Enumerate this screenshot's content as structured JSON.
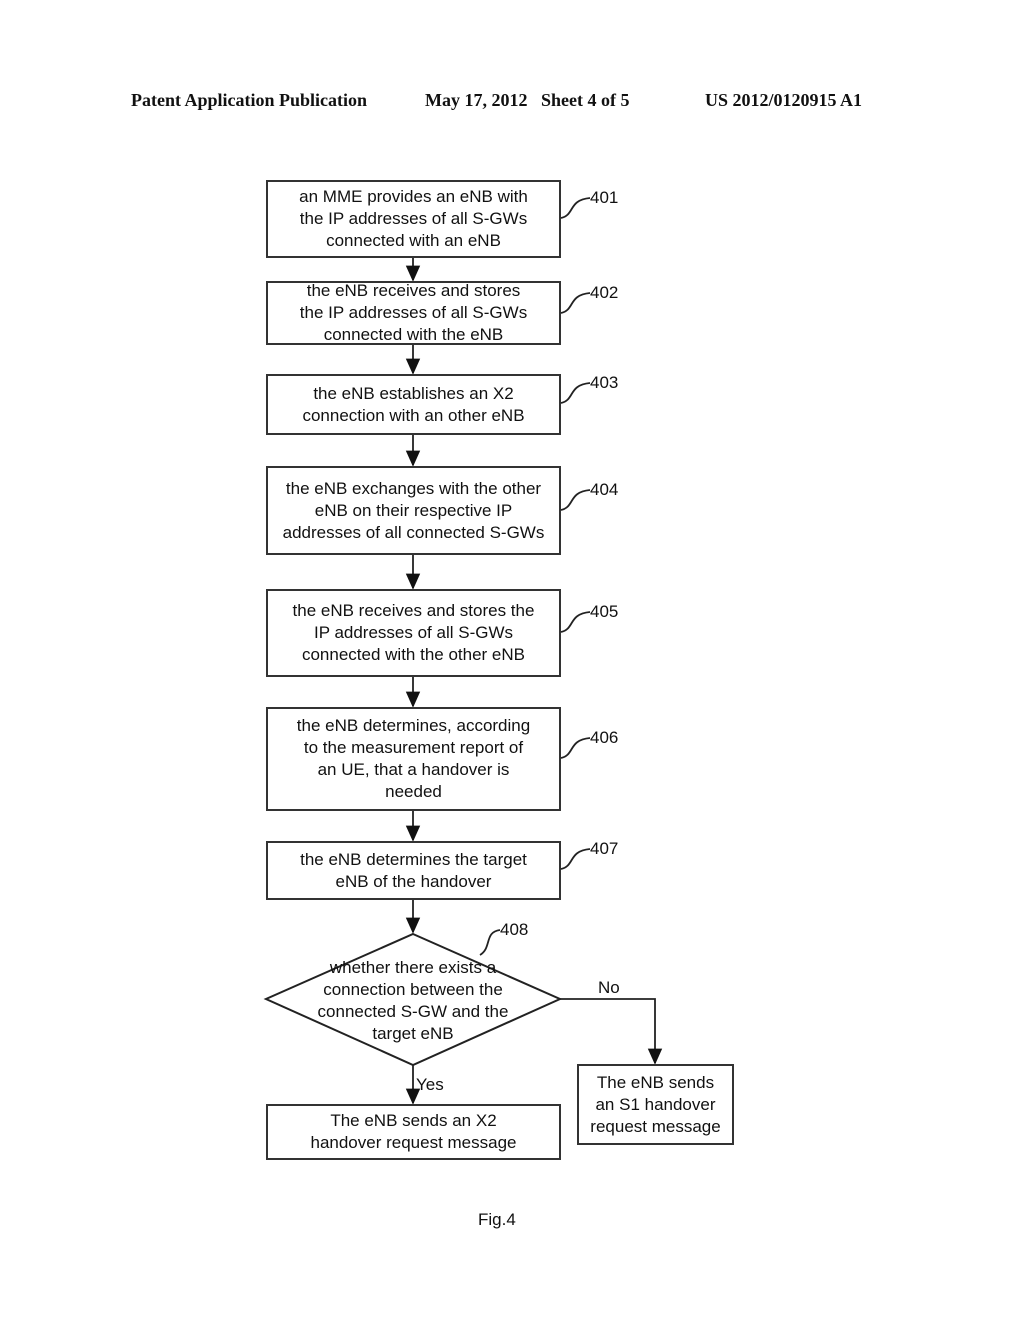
{
  "header": {
    "publication": "Patent Application Publication",
    "date_sheet": "May 17, 2012   Sheet 4 of 5",
    "number": "US 2012/0120915 A1"
  },
  "steps": [
    {
      "ref": "401",
      "text": "an MME provides an eNB with\nthe IP addresses of all S-GWs\nconnected with an eNB"
    },
    {
      "ref": "402",
      "text": "the eNB receives and stores\nthe IP addresses of all S-GWs\nconnected with the eNB"
    },
    {
      "ref": "403",
      "text": "the eNB establishes an X2\nconnection with an other eNB"
    },
    {
      "ref": "404",
      "text": "the eNB exchanges with the other\neNB on their respective IP\naddresses of all connected S-GWs"
    },
    {
      "ref": "405",
      "text": "the eNB receives and stores the\nIP addresses of all  S-GWs\nconnected with the other eNB"
    },
    {
      "ref": "406",
      "text": "the eNB determines, according\nto the measurement report of\nan UE, that a handover is\nneeded"
    },
    {
      "ref": "407",
      "text": "the eNB determines the target\neNB of the handover"
    }
  ],
  "decision": {
    "ref": "408",
    "text": "whether there exists a\nconnection  between the\nconnected  S-GW and the\ntarget   eNB"
  },
  "branches": {
    "yes_label": "Yes",
    "no_label": "No"
  },
  "outcomes": {
    "yes": "The eNB sends an X2\nhandover request message",
    "no": "The eNB sends\nan S1 handover\nrequest message"
  },
  "figure_label": "Fig.4"
}
